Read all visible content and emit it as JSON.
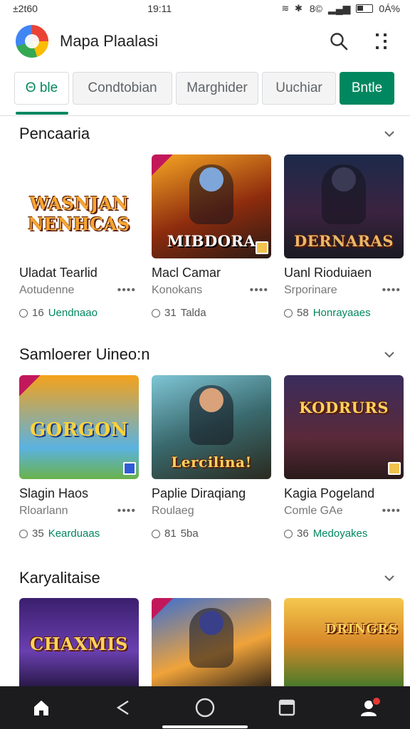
{
  "status_bar": {
    "time_left": "±2t60",
    "time_center": "19:11",
    "signal_text": "8©",
    "battery": "0Á%"
  },
  "app_bar": {
    "title": "Mapa Plaalasi",
    "logo": "store-logo",
    "search_icon": "search-icon",
    "menu_icon": "more-icon"
  },
  "tabs": [
    {
      "label": "Θ ble",
      "state": "active"
    },
    {
      "label": "Condtobian"
    },
    {
      "label": "Marghider"
    },
    {
      "label": "Uuchiar"
    },
    {
      "label": "Bntle",
      "state": "cta"
    }
  ],
  "sections": [
    {
      "title": "Pencaaria",
      "cards": [
        {
          "art": "WASNJAN NENHCAS",
          "title": "Uladat Tearlid",
          "subtitle": "Aotudenne",
          "rating": "16",
          "tag": "Uendnaao",
          "tag_colored": true
        },
        {
          "art": "MIBDORA",
          "title": "Macl Camar",
          "subtitle": "Konokans",
          "rating": "31",
          "tag": "Talda",
          "tag_colored": false
        },
        {
          "art": "DERNARAS",
          "title": "Uanl Rioduiaen",
          "subtitle": "Srporinare",
          "rating": "58",
          "tag": "Honrayaaes",
          "tag_colored": true
        }
      ]
    },
    {
      "title": "Samloerer Uineo:n",
      "cards": [
        {
          "art": "GORGON",
          "title": "Slagin Haos",
          "subtitle": "Rloarlann",
          "rating": "35",
          "tag": "Kearduaas",
          "tag_colored": true
        },
        {
          "art": "Lercilina!",
          "title": "Paplie Diraqiang",
          "subtitle": "Roulaeg",
          "rating": "81",
          "tag": "5ba",
          "tag_colored": false
        },
        {
          "art": "KODRURS",
          "title": "Kagia Pogeland",
          "subtitle": "Comle GAe",
          "rating": "36",
          "tag": "Medoyakes",
          "tag_colored": true
        }
      ]
    },
    {
      "title": "Karyalitaise",
      "cards": [
        {
          "art": "CHAXMIS"
        },
        {
          "art": ""
        },
        {
          "art": "DRINGRS"
        }
      ]
    }
  ],
  "bottom_nav": [
    "home-icon",
    "share-icon",
    "circle-icon",
    "square-icon",
    "profile-icon"
  ],
  "colors": {
    "accent": "#01875f",
    "nav_bg": "#1c1c1e",
    "notification": "#e53935"
  }
}
